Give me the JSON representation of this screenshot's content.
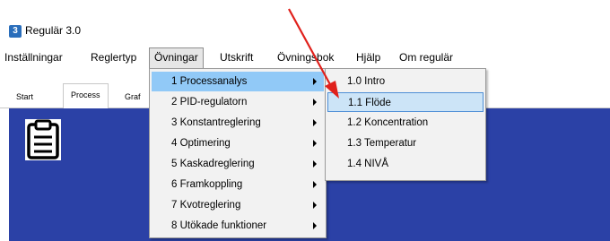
{
  "app": {
    "title": "Regulär 3.0",
    "icon_glyph": "3"
  },
  "menubar": {
    "items": [
      {
        "label": "Inställningar"
      },
      {
        "label": "Reglertyp"
      },
      {
        "label": "Övningar"
      },
      {
        "label": "Utskrift"
      },
      {
        "label": "Övningsbok"
      },
      {
        "label": "Hjälp"
      },
      {
        "label": "Om regulär"
      }
    ]
  },
  "tabs": [
    {
      "label": "Start"
    },
    {
      "label": "Process"
    },
    {
      "label": "Graf"
    }
  ],
  "ovningar_menu": {
    "items": [
      {
        "label": "1 Processanalys"
      },
      {
        "label": "2 PID-regulatorn"
      },
      {
        "label": "3 Konstantreglering"
      },
      {
        "label": "4 Optimering"
      },
      {
        "label": "5 Kaskadreglering"
      },
      {
        "label": "6 Framkoppling"
      },
      {
        "label": "7 Kvotreglering"
      },
      {
        "label": "8 Utökade funktioner"
      }
    ]
  },
  "processanalys_submenu": {
    "items": [
      {
        "label": "1.0 Intro"
      },
      {
        "label": "1.1 Flöde"
      },
      {
        "label": "1.2 Koncentration"
      },
      {
        "label": "1.3 Temperatur"
      },
      {
        "label": "1.4 NIVÅ"
      }
    ]
  },
  "colors": {
    "panel": "#2b41a6",
    "highlight": "#91c9f7",
    "annotation_arrow": "#e0201b"
  },
  "icons": {
    "app_icon": "app-icon",
    "clipboard": "clipboard-icon",
    "submenu": "chevron-right-icon",
    "annotation": "red-arrow"
  }
}
